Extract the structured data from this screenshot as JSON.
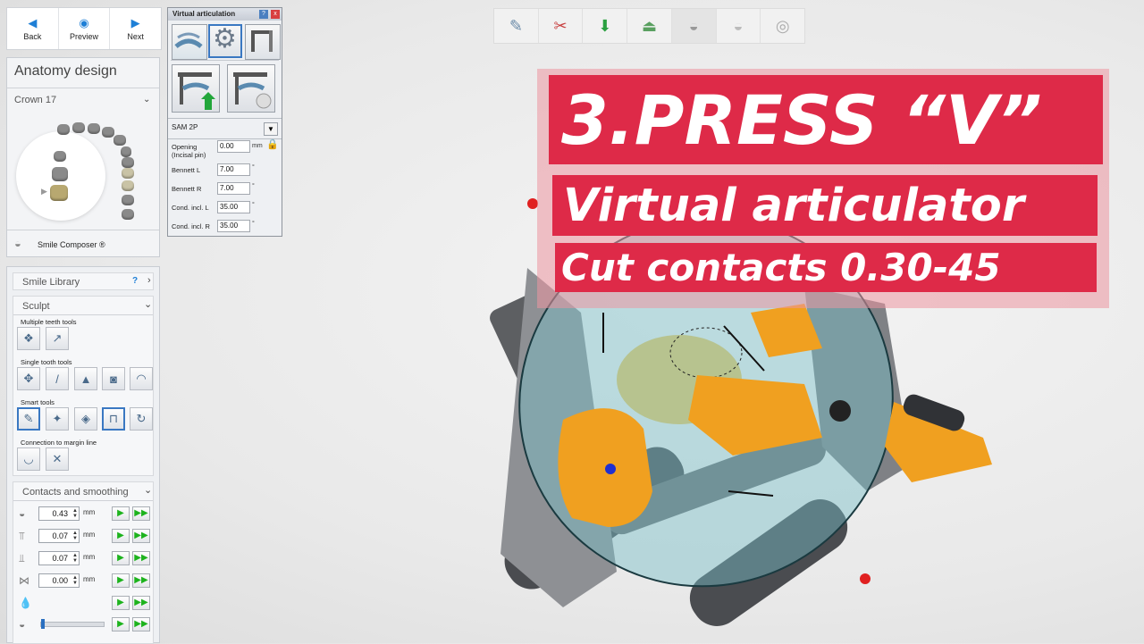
{
  "nav": {
    "back": "Back",
    "preview": "Preview",
    "next": "Next"
  },
  "anatomy": {
    "title": "Anatomy design",
    "crown": "Crown 17",
    "smile_composer": "Smile Composer ®"
  },
  "smile_library": {
    "title": "Smile Library",
    "help": "?"
  },
  "sculpt": {
    "title": "Sculpt",
    "multiple_label": "Multiple teeth tools",
    "single_label": "Single tooth tools",
    "smart_label": "Smart tools",
    "connection_label": "Connection to margin line"
  },
  "contacts": {
    "title": "Contacts and smoothing",
    "unit": "mm",
    "values": [
      "0.43",
      "0.07",
      "0.07",
      "0.00"
    ]
  },
  "virtual_articulation": {
    "title": "Virtual articulation",
    "help": "?",
    "close": "x",
    "articulator": "SAM 2P",
    "opening_label": "Opening\n(Incisal pin)",
    "opening_value": "0.00",
    "opening_unit": "mm",
    "bennett_l_label": "Bennett L",
    "bennett_l_value": "7.00",
    "bennett_r_label": "Bennett R",
    "bennett_r_value": "7.00",
    "cond_l_label": "Cond. incl. L",
    "cond_l_value": "35.00",
    "cond_r_label": "Cond. incl. R",
    "cond_r_value": "35.00",
    "degree": "°"
  },
  "overlay": {
    "line1": "3.PRESS “V”",
    "line2": "Virtual articulator",
    "line3": "Cut contacts 0.30-45"
  },
  "colors": {
    "banner_red": "#de2a48",
    "accent_blue": "#1e7fd6",
    "articulator_orange": "#f0a020"
  }
}
